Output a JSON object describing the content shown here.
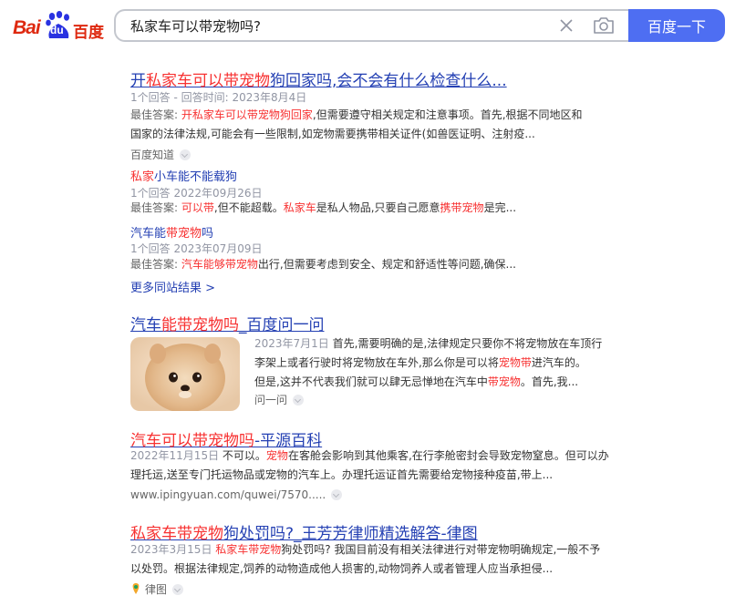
{
  "header": {
    "logo_bai": "Bai",
    "logo_du": "du",
    "logo_cn": "百度",
    "search_query": "私家车可以带宠物吗?",
    "search_button": "百度一下"
  },
  "results": [
    {
      "title_pre": "开",
      "title_hl": "私家车可以带宠物",
      "title_post": "狗回家吗,会不会有什么检查什么...",
      "meta": "1个回答 - 回答时间: 2023年8月4日",
      "snippet_prefix": "最佳答案: ",
      "snippet_hl": "开私家车可以带宠物狗回家",
      "snippet_rest1": ",但需要遵守相关规定和注意事项。首先,根据不同地区和",
      "snippet_line2": "国家的法律法规,可能会有一些限制,如宠物需要携带相关证件(如兽医证明、注射疫...",
      "source": "百度知道",
      "sub_items": [
        {
          "title_hl": "私家",
          "title_rest": "小车能不能载狗",
          "meta": "1个回答   2022年09月26日",
          "snip_prefix": "最佳答案: ",
          "snip_hl1": "可以带",
          "snip_mid1": ",但不能超载。",
          "snip_hl2": "私家车",
          "snip_mid2": "是私人物品,只要自己愿意",
          "snip_hl3": "携带宠物",
          "snip_end": "是完..."
        },
        {
          "title_pre": "汽车能",
          "title_hl": "带宠物",
          "title_rest": "吗",
          "meta": "1个回答   2023年07月09日",
          "snip_prefix": "最佳答案: ",
          "snip_hl1": "汽车能够带宠物",
          "snip_end": "出行,但需要考虑到安全、规定和舒适性等问题,确保..."
        }
      ],
      "more": "更多同站结果 >"
    },
    {
      "title_pre": "汽车",
      "title_hl": "能带宠物吗",
      "title_post": "_百度问一问",
      "date": "2023年7月1日",
      "line1": " 首先,需要明确的是,法律规定只要你不将宠物放在车顶行",
      "line2": "李架上或者行驶时将宠物放在车外,那么你是可以将",
      "line2_hl": "宠物带",
      "line2_end": "进汽车的。",
      "line3": "但是,这并不代表我们就可以肆无忌惮地在汽车中",
      "line3_hl": "带宠物",
      "line3_end": "。首先,我...",
      "source": "问一问"
    },
    {
      "title_hl": "汽车可以带宠物吗",
      "title_post": "-平源百科",
      "date": "2022年11月15日",
      "line1": " 不可以。",
      "line1_hl": "宠物",
      "line1_end": "在客舱会影响到其他乘客,在行李舱密封会导致宠物窒息。但可以办",
      "line2": "理托运,送至专门托运物品或宠物的汽车上。办理托运证首先需要给宠物接种疫苗,带上...",
      "url": "www.ipingyuan.com/quwei/7570....."
    },
    {
      "title_hl": "私家车带宠物",
      "title_post": "狗处罚吗?_王芳芳律师精选解答-律图",
      "date": "2023年3月15日",
      "line1_hl": "私家车带宠物",
      "line1_end": "狗处罚吗? 我国目前没有相关法律进行对带宠物明确规定,一般不予",
      "line2": "以处罚。根据法律规定,饲养的动物造成他人损害的,动物饲养人或者管理人应当承担侵...",
      "source": "律图"
    }
  ],
  "colors": {
    "brand_red": "#de2910",
    "brand_blue": "#2932e1",
    "button_blue": "#4e6ef2",
    "link_blue": "#2440b3",
    "highlight_red": "#f73131"
  }
}
